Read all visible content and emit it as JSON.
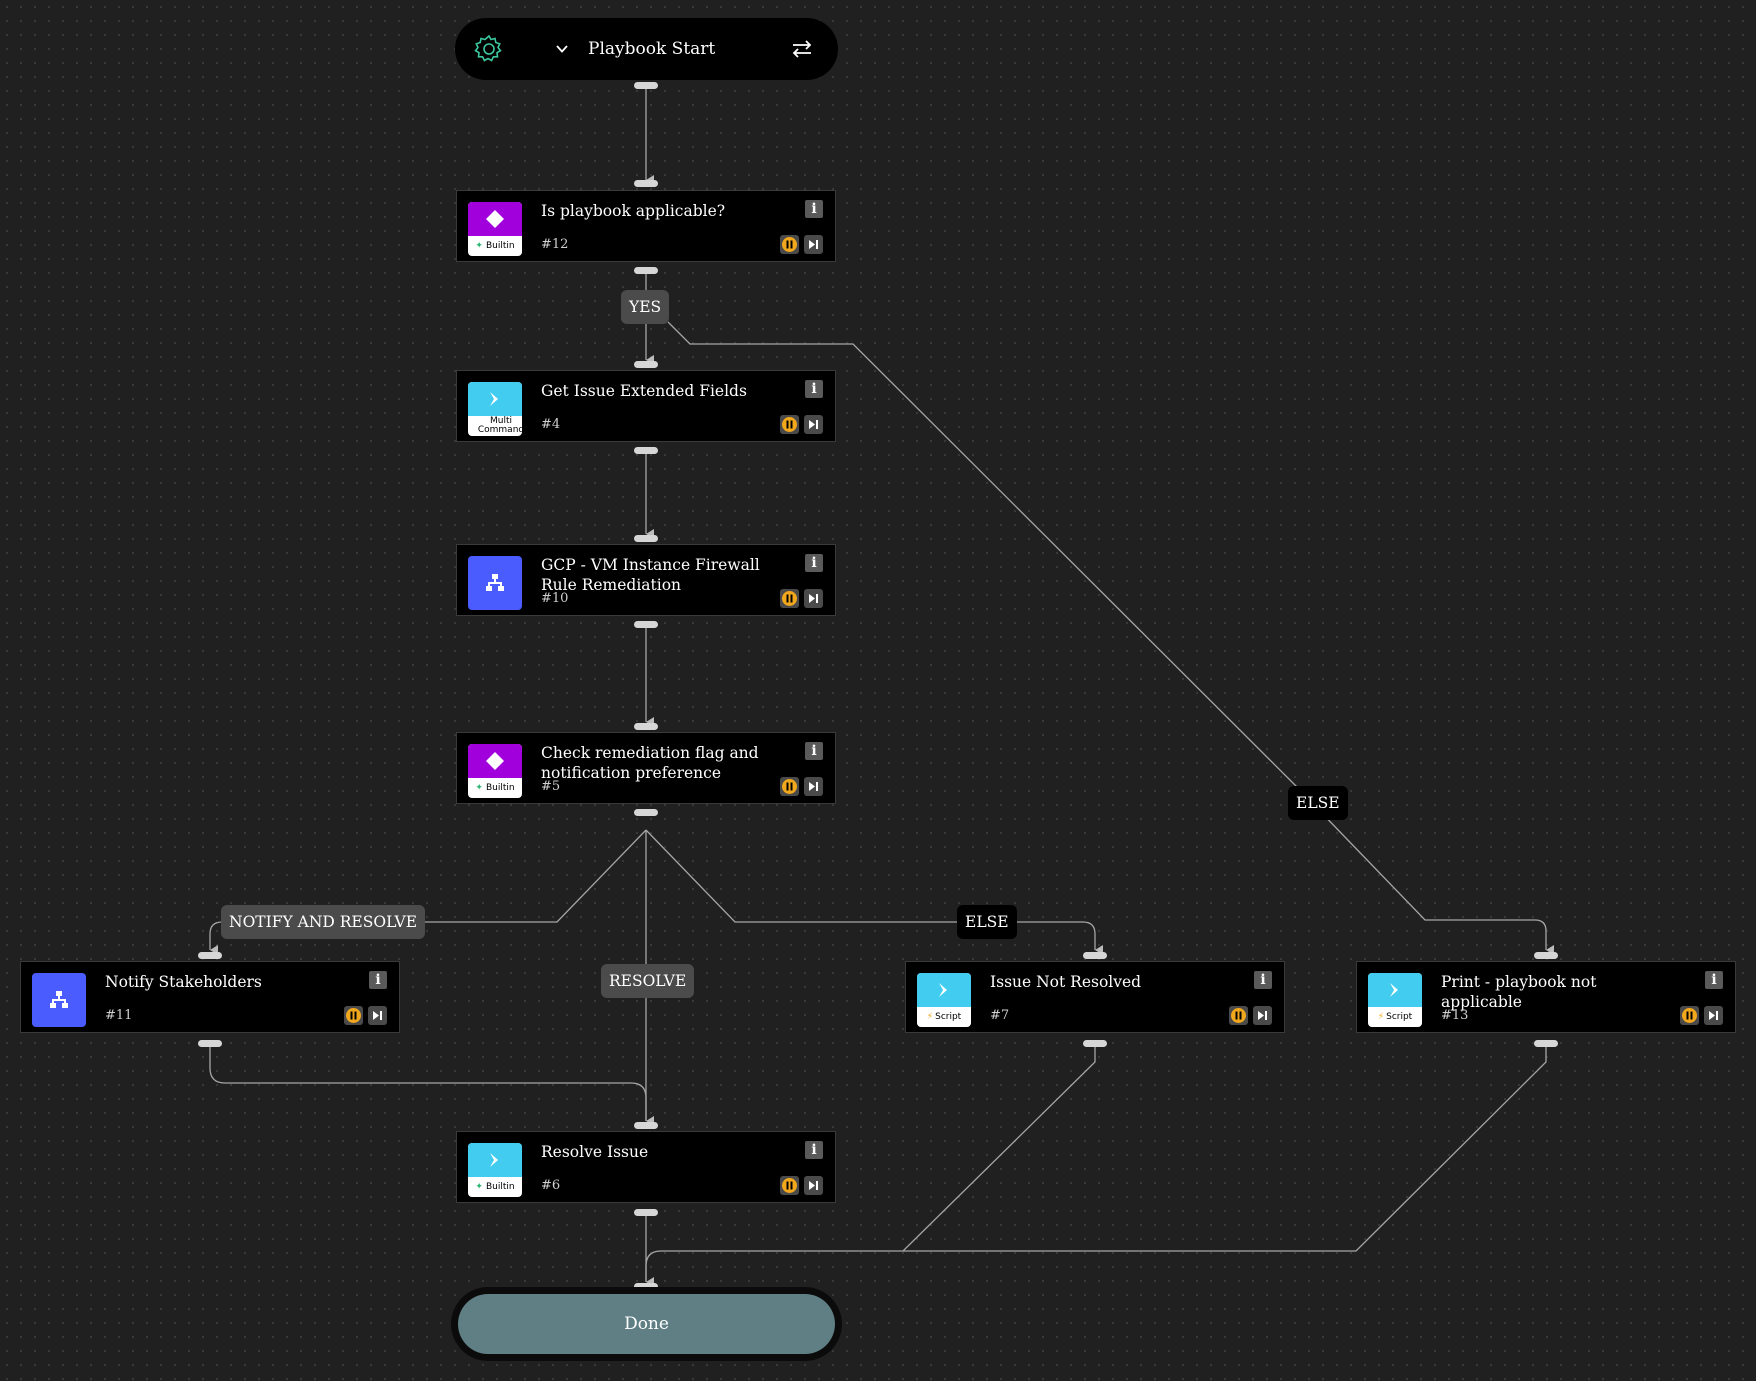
{
  "start": {
    "title": "Playbook Start",
    "icons": [
      "gear-icon",
      "chevron-down-icon",
      "swap-arrows-icon"
    ]
  },
  "nodes": [
    {
      "id": "n12",
      "title": "Is playbook applicable?",
      "number": "#12",
      "tile": "purple",
      "badge": "Builtin",
      "icon": "diamond-icon"
    },
    {
      "id": "n4",
      "title": "Get Issue Extended Fields",
      "number": "#4",
      "tile": "cyan",
      "badge": "Multi Command",
      "icon": "chevron-right-icon"
    },
    {
      "id": "n10",
      "title": "GCP - VM Instance Firewall Rule Remediation",
      "number": "#10",
      "tile": "blue",
      "badge": "",
      "icon": "sub-playbook-icon"
    },
    {
      "id": "n5",
      "title": "Check remediation flag and notification preference",
      "number": "#5",
      "tile": "purple",
      "badge": "Builtin",
      "icon": "diamond-icon"
    },
    {
      "id": "n11",
      "title": "Notify Stakeholders",
      "number": "#11",
      "tile": "blue",
      "badge": "",
      "icon": "sub-playbook-icon"
    },
    {
      "id": "n7",
      "title": "Issue Not Resolved",
      "number": "#7",
      "tile": "cyan",
      "badge": "Script",
      "icon": "chevron-right-icon"
    },
    {
      "id": "n13",
      "title": "Print - playbook not applicable",
      "number": "#13",
      "tile": "cyan",
      "badge": "Script",
      "icon": "chevron-right-icon"
    },
    {
      "id": "n6",
      "title": "Resolve Issue",
      "number": "#6",
      "tile": "cyan",
      "badge": "Builtin",
      "icon": "chevron-right-icon"
    }
  ],
  "edge_labels": {
    "yes": "YES",
    "else_top": "ELSE",
    "notify_and_resolve": "NOTIFY AND RESOLVE",
    "resolve": "RESOLVE",
    "else_mid": "ELSE"
  },
  "done": {
    "title": "Done"
  },
  "colors": {
    "canvas": "#202020",
    "builtin_purple": "#a100dc",
    "script_cyan": "#42ccef",
    "playbook_blue": "#4b5cff",
    "breakpoint_orange": "#f2a81d",
    "done_fill": "#5f7f84",
    "start_gear": "#3cc8a0"
  }
}
